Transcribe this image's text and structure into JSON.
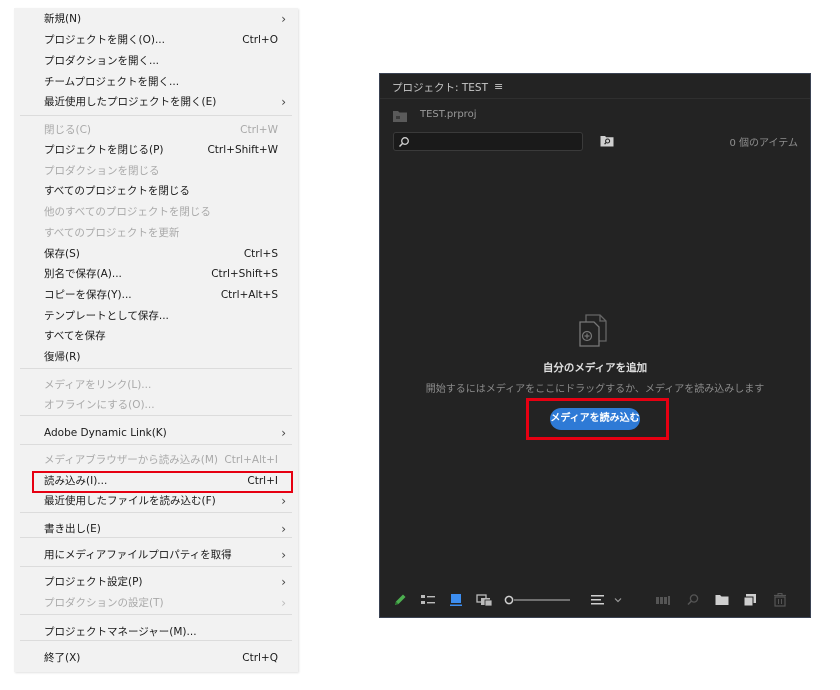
{
  "menu": {
    "items": [
      {
        "label": "新規(N)",
        "shortcut": "",
        "submenu": true,
        "disabled": false
      },
      {
        "label": "プロジェクトを開く(O)...",
        "shortcut": "Ctrl+O",
        "submenu": false,
        "disabled": false
      },
      {
        "label": "プロダクションを開く...",
        "shortcut": "",
        "submenu": false,
        "disabled": false
      },
      {
        "label": "チームプロジェクトを開く...",
        "shortcut": "",
        "submenu": false,
        "disabled": false
      },
      {
        "label": "最近使用したプロジェクトを開く(E)",
        "shortcut": "",
        "submenu": true,
        "disabled": false
      },
      {
        "label": "閉じる(C)",
        "shortcut": "Ctrl+W",
        "submenu": false,
        "disabled": true
      },
      {
        "label": "プロジェクトを閉じる(P)",
        "shortcut": "Ctrl+Shift+W",
        "submenu": false,
        "disabled": false
      },
      {
        "label": "プロダクションを閉じる",
        "shortcut": "",
        "submenu": false,
        "disabled": true
      },
      {
        "label": "すべてのプロジェクトを閉じる",
        "shortcut": "",
        "submenu": false,
        "disabled": false
      },
      {
        "label": "他のすべてのプロジェクトを閉じる",
        "shortcut": "",
        "submenu": false,
        "disabled": true
      },
      {
        "label": "すべてのプロジェクトを更新",
        "shortcut": "",
        "submenu": false,
        "disabled": true
      },
      {
        "label": "保存(S)",
        "shortcut": "Ctrl+S",
        "submenu": false,
        "disabled": false
      },
      {
        "label": "別名で保存(A)...",
        "shortcut": "Ctrl+Shift+S",
        "submenu": false,
        "disabled": false
      },
      {
        "label": "コピーを保存(Y)...",
        "shortcut": "Ctrl+Alt+S",
        "submenu": false,
        "disabled": false
      },
      {
        "label": "テンプレートとして保存...",
        "shortcut": "",
        "submenu": false,
        "disabled": false
      },
      {
        "label": "すべてを保存",
        "shortcut": "",
        "submenu": false,
        "disabled": false
      },
      {
        "label": "復帰(R)",
        "shortcut": "",
        "submenu": false,
        "disabled": false
      },
      {
        "label": "メディアをリンク(L)...",
        "shortcut": "",
        "submenu": false,
        "disabled": true
      },
      {
        "label": "オフラインにする(O)...",
        "shortcut": "",
        "submenu": false,
        "disabled": true
      },
      {
        "label": "Adobe Dynamic Link(K)",
        "shortcut": "",
        "submenu": true,
        "disabled": false
      },
      {
        "label": "メディアブラウザーから読み込み(M)",
        "shortcut": "Ctrl+Alt+I",
        "submenu": false,
        "disabled": true
      },
      {
        "label": "読み込み(I)...",
        "shortcut": "Ctrl+I",
        "submenu": false,
        "disabled": false
      },
      {
        "label": "最近使用したファイルを読み込む(F)",
        "shortcut": "",
        "submenu": true,
        "disabled": false
      },
      {
        "label": "書き出し(E)",
        "shortcut": "",
        "submenu": true,
        "disabled": false
      },
      {
        "label": "用にメディアファイルプロパティを取得",
        "shortcut": "",
        "submenu": true,
        "disabled": false
      },
      {
        "label": "プロジェクト設定(P)",
        "shortcut": "",
        "submenu": true,
        "disabled": false
      },
      {
        "label": "プロダクションの設定(T)",
        "shortcut": "",
        "submenu": true,
        "disabled": true
      },
      {
        "label": "プロジェクトマネージャー(M)...",
        "shortcut": "",
        "submenu": false,
        "disabled": false
      },
      {
        "label": "終了(X)",
        "shortcut": "Ctrl+Q",
        "submenu": false,
        "disabled": false
      }
    ]
  },
  "panel": {
    "title": "プロジェクト: TEST",
    "menu_icon": "≡",
    "file_name": "TEST.prproj",
    "search_placeholder": "",
    "item_count": "0 個のアイテム",
    "empty_title": "自分のメディアを追加",
    "empty_subtitle": "開始するにはメディアをここにドラッグするか、メディアを読み込みします",
    "import_button": "メディアを読み込む"
  },
  "icons": {
    "submenu_arrow": "chevron-right-icon",
    "pen": "pen-icon",
    "list_view": "list-view-icon",
    "icon_view": "icon-view-icon",
    "freeform_view": "freeform-view-icon",
    "sort": "sort-icon",
    "automate": "automate-to-sequence-icon",
    "find": "find-icon",
    "new_bin": "new-bin-icon",
    "new_item": "new-item-icon",
    "delete": "trash-icon"
  },
  "colors": {
    "highlight_red": "#e60012",
    "accent_blue": "#2e7ad6",
    "pen_green": "#4caf50"
  }
}
